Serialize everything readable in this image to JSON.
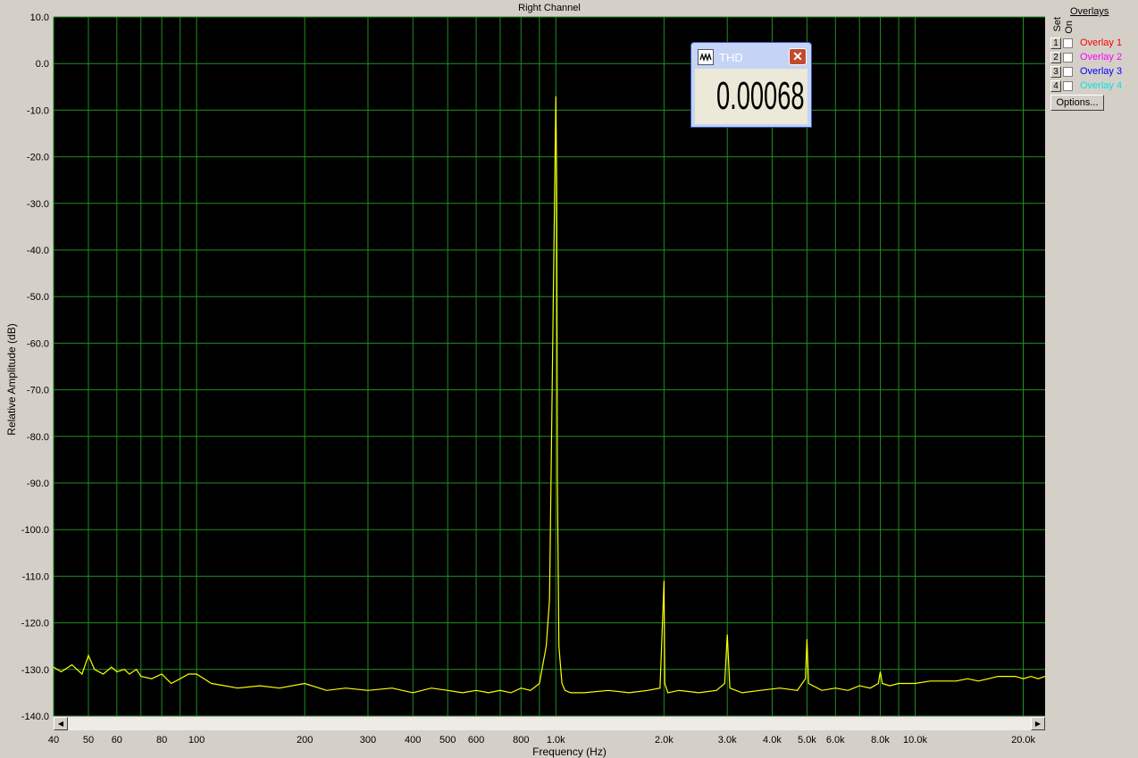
{
  "chart_data": {
    "type": "line",
    "title": "Right Channel",
    "xlabel": "Frequency (Hz)",
    "ylabel": "Relative Amplitude (dB)",
    "xscale": "log",
    "xlim": [
      40,
      23000
    ],
    "ylim": [
      -140,
      10
    ],
    "grid": true,
    "xticks": [
      {
        "v": 40,
        "label": "40"
      },
      {
        "v": 50,
        "label": "50"
      },
      {
        "v": 60,
        "label": "60"
      },
      {
        "v": 80,
        "label": "80"
      },
      {
        "v": 100,
        "label": "100"
      },
      {
        "v": 200,
        "label": "200"
      },
      {
        "v": 300,
        "label": "300"
      },
      {
        "v": 400,
        "label": "400"
      },
      {
        "v": 500,
        "label": "500"
      },
      {
        "v": 600,
        "label": "600"
      },
      {
        "v": 800,
        "label": "800"
      },
      {
        "v": 1000,
        "label": "1.0k"
      },
      {
        "v": 2000,
        "label": "2.0k"
      },
      {
        "v": 3000,
        "label": "3.0k"
      },
      {
        "v": 4000,
        "label": "4.0k"
      },
      {
        "v": 5000,
        "label": "5.0k"
      },
      {
        "v": 6000,
        "label": "6.0k"
      },
      {
        "v": 8000,
        "label": "8.0k"
      },
      {
        "v": 10000,
        "label": "10.0k"
      },
      {
        "v": 20000,
        "label": "20.0k"
      }
    ],
    "yticks": [
      {
        "v": 10,
        "label": "10.0"
      },
      {
        "v": 0,
        "label": "0.0"
      },
      {
        "v": -10,
        "label": "-10.0"
      },
      {
        "v": -20,
        "label": "-20.0"
      },
      {
        "v": -30,
        "label": "-30.0"
      },
      {
        "v": -40,
        "label": "-40.0"
      },
      {
        "v": -50,
        "label": "-50.0"
      },
      {
        "v": -60,
        "label": "-60.0"
      },
      {
        "v": -70,
        "label": "-70.0"
      },
      {
        "v": -80,
        "label": "-80.0"
      },
      {
        "v": -90,
        "label": "-90.0"
      },
      {
        "v": -100,
        "label": "-100.0"
      },
      {
        "v": -110,
        "label": "-110.0"
      },
      {
        "v": -120,
        "label": "-120.0"
      },
      {
        "v": -130,
        "label": "-130.0"
      },
      {
        "v": -140,
        "label": "-140.0"
      }
    ],
    "series": [
      {
        "color": "#ffff00",
        "x": [
          40,
          42,
          45,
          48,
          50,
          52,
          55,
          58,
          60,
          63,
          65,
          68,
          70,
          75,
          80,
          85,
          90,
          95,
          100,
          110,
          120,
          130,
          150,
          170,
          200,
          230,
          260,
          300,
          350,
          400,
          450,
          500,
          550,
          600,
          650,
          700,
          750,
          800,
          850,
          900,
          940,
          960,
          980,
          995,
          1000,
          1005,
          1010,
          1020,
          1040,
          1060,
          1100,
          1200,
          1400,
          1600,
          1800,
          1950,
          2000,
          2010,
          2050,
          2200,
          2500,
          2800,
          2950,
          3000,
          3050,
          3300,
          3700,
          4200,
          4700,
          4950,
          5000,
          5050,
          5500,
          6000,
          6500,
          7000,
          7500,
          7900,
          8000,
          8100,
          8500,
          9000,
          10000,
          11000,
          12000,
          13000,
          14000,
          15000,
          16000,
          17000,
          18000,
          19000,
          20000,
          21000,
          22000,
          23000
        ],
        "y": [
          -129.5,
          -130.5,
          -129,
          -131,
          -127,
          -130,
          -131,
          -129.5,
          -130.5,
          -130,
          -131,
          -130,
          -131.5,
          -132,
          -131,
          -133,
          -132,
          -131,
          -131,
          -133,
          -133.5,
          -134,
          -133.5,
          -134,
          -133,
          -134.5,
          -134,
          -134.5,
          -134,
          -135,
          -134,
          -134.5,
          -135,
          -134.5,
          -135,
          -134.5,
          -135,
          -134,
          -134.5,
          -133,
          -125,
          -115,
          -60,
          -20,
          -7,
          -26,
          -90,
          -125,
          -133,
          -134.5,
          -135,
          -135,
          -134.5,
          -135,
          -134.5,
          -134,
          -111,
          -133,
          -135,
          -134.5,
          -135,
          -134.5,
          -133,
          -122.5,
          -134,
          -135,
          -134.5,
          -134,
          -134.5,
          -132,
          -123.5,
          -133,
          -134.5,
          -134,
          -134.5,
          -133.5,
          -134,
          -133,
          -130.5,
          -133,
          -133.5,
          -133,
          -133,
          -132.5,
          -132.5,
          -132.5,
          -132,
          -132.5,
          -132,
          -131.5,
          -131.5,
          -131.5,
          -132,
          -131.5,
          -132,
          -131.5
        ]
      }
    ]
  },
  "overlays": {
    "heading": "Overlays",
    "set_label": "Set",
    "on_label": "On",
    "items": [
      {
        "num": "1",
        "label": "Overlay 1",
        "color": "#ff0000"
      },
      {
        "num": "2",
        "label": "Overlay 2",
        "color": "#ff00ff"
      },
      {
        "num": "3",
        "label": "Overlay 3",
        "color": "#0000ff"
      },
      {
        "num": "4",
        "label": "Overlay 4",
        "color": "#00e5e5"
      }
    ],
    "options_label": "Options..."
  },
  "thd": {
    "title": "THD",
    "value": "0.00068 %"
  },
  "scroll": {
    "left": "◀",
    "right": "▶"
  }
}
